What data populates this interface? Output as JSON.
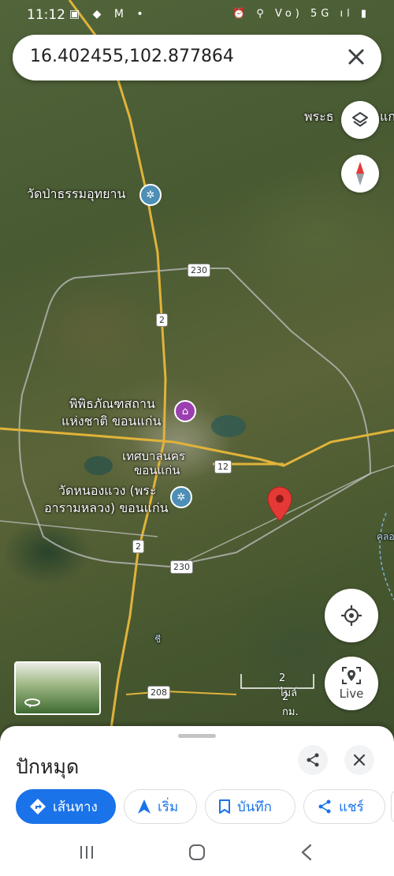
{
  "status": {
    "time": "11:12",
    "left_icons": "▣ ◆ M •",
    "right_icons": "⏰ ⚲ Vo) 5G ıl ▮"
  },
  "search": {
    "value": "16.402455,102.877864"
  },
  "map": {
    "labels": {
      "top_right": "พระธ",
      "top_right_2": "แก",
      "wat_pa": "วัดป่าธรรมอุทยาน",
      "museum_1": "พิพิธภัณฑสถาน",
      "museum_2": "แห่งชาติ ขอนแก่น",
      "city_1": "เทศบาลนคร",
      "city_2": "ขอนแก่น",
      "wat_nong_1": "วัดหนองแวง (พระ",
      "wat_nong_2": "อารามหลวง) ขอนแก่น",
      "right_edge": "คลอง",
      "small_label": "ชี"
    },
    "shields": {
      "r230_top": "230",
      "r2_top": "2",
      "r12": "12",
      "r2_bottom": "2",
      "r230_bottom": "230",
      "r208": "208"
    },
    "scale": {
      "miles": "2 ไมล์",
      "km": "2 กม."
    },
    "live_label": "Live",
    "colors": {
      "pin": "#e53935",
      "route_yellow": "#e0b33a",
      "poi_temple": "#4d8fb5",
      "poi_museum": "#9c3fb0"
    }
  },
  "sheet": {
    "title": "ปักหมุด",
    "chips": {
      "directions": "เส้นทาง",
      "start": "เริ่ม",
      "save": "บันทึก",
      "share": "แชร์"
    }
  },
  "icons": [
    "close-icon",
    "layers-icon",
    "compass-icon",
    "my-location-icon",
    "live-view-icon",
    "share-icon",
    "directions-icon",
    "navigation-icon",
    "bookmark-icon",
    "pin-icon",
    "recents-icon",
    "home-icon",
    "back-icon"
  ]
}
